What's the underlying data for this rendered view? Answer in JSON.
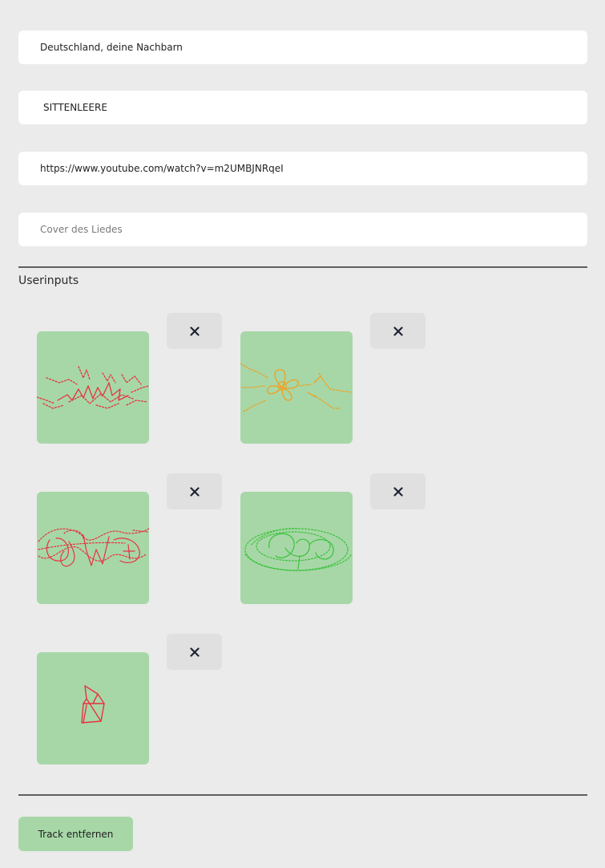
{
  "form": {
    "artist_value": "Deutschland, deine Nachbarn",
    "title_value": "SITTENLEERE",
    "url_value": "https://www.youtube.com/watch?v=m2UMBJNRqeI",
    "cover_placeholder": "Cover des Liedes"
  },
  "userinputs": {
    "heading": "Userinputs",
    "remove_symbol": "×",
    "items": [
      {
        "stroke_color": "#e8323f",
        "motif": "spiky-burst"
      },
      {
        "stroke_color": "#f0a023",
        "motif": "flower-rays"
      },
      {
        "stroke_color": "#e8323f",
        "motif": "loop-scribble"
      },
      {
        "stroke_color": "#3cc23c",
        "motif": "loop-scribble"
      },
      {
        "stroke_color": "#e8323f",
        "motif": "small-house"
      }
    ]
  },
  "actions": {
    "remove_track_label": "Track entfernen"
  },
  "colors": {
    "background": "#ebebeb",
    "accent_green": "#a7d7a7",
    "remove_button_bg": "#e0e0e0",
    "divider": "#5f5f5f"
  }
}
